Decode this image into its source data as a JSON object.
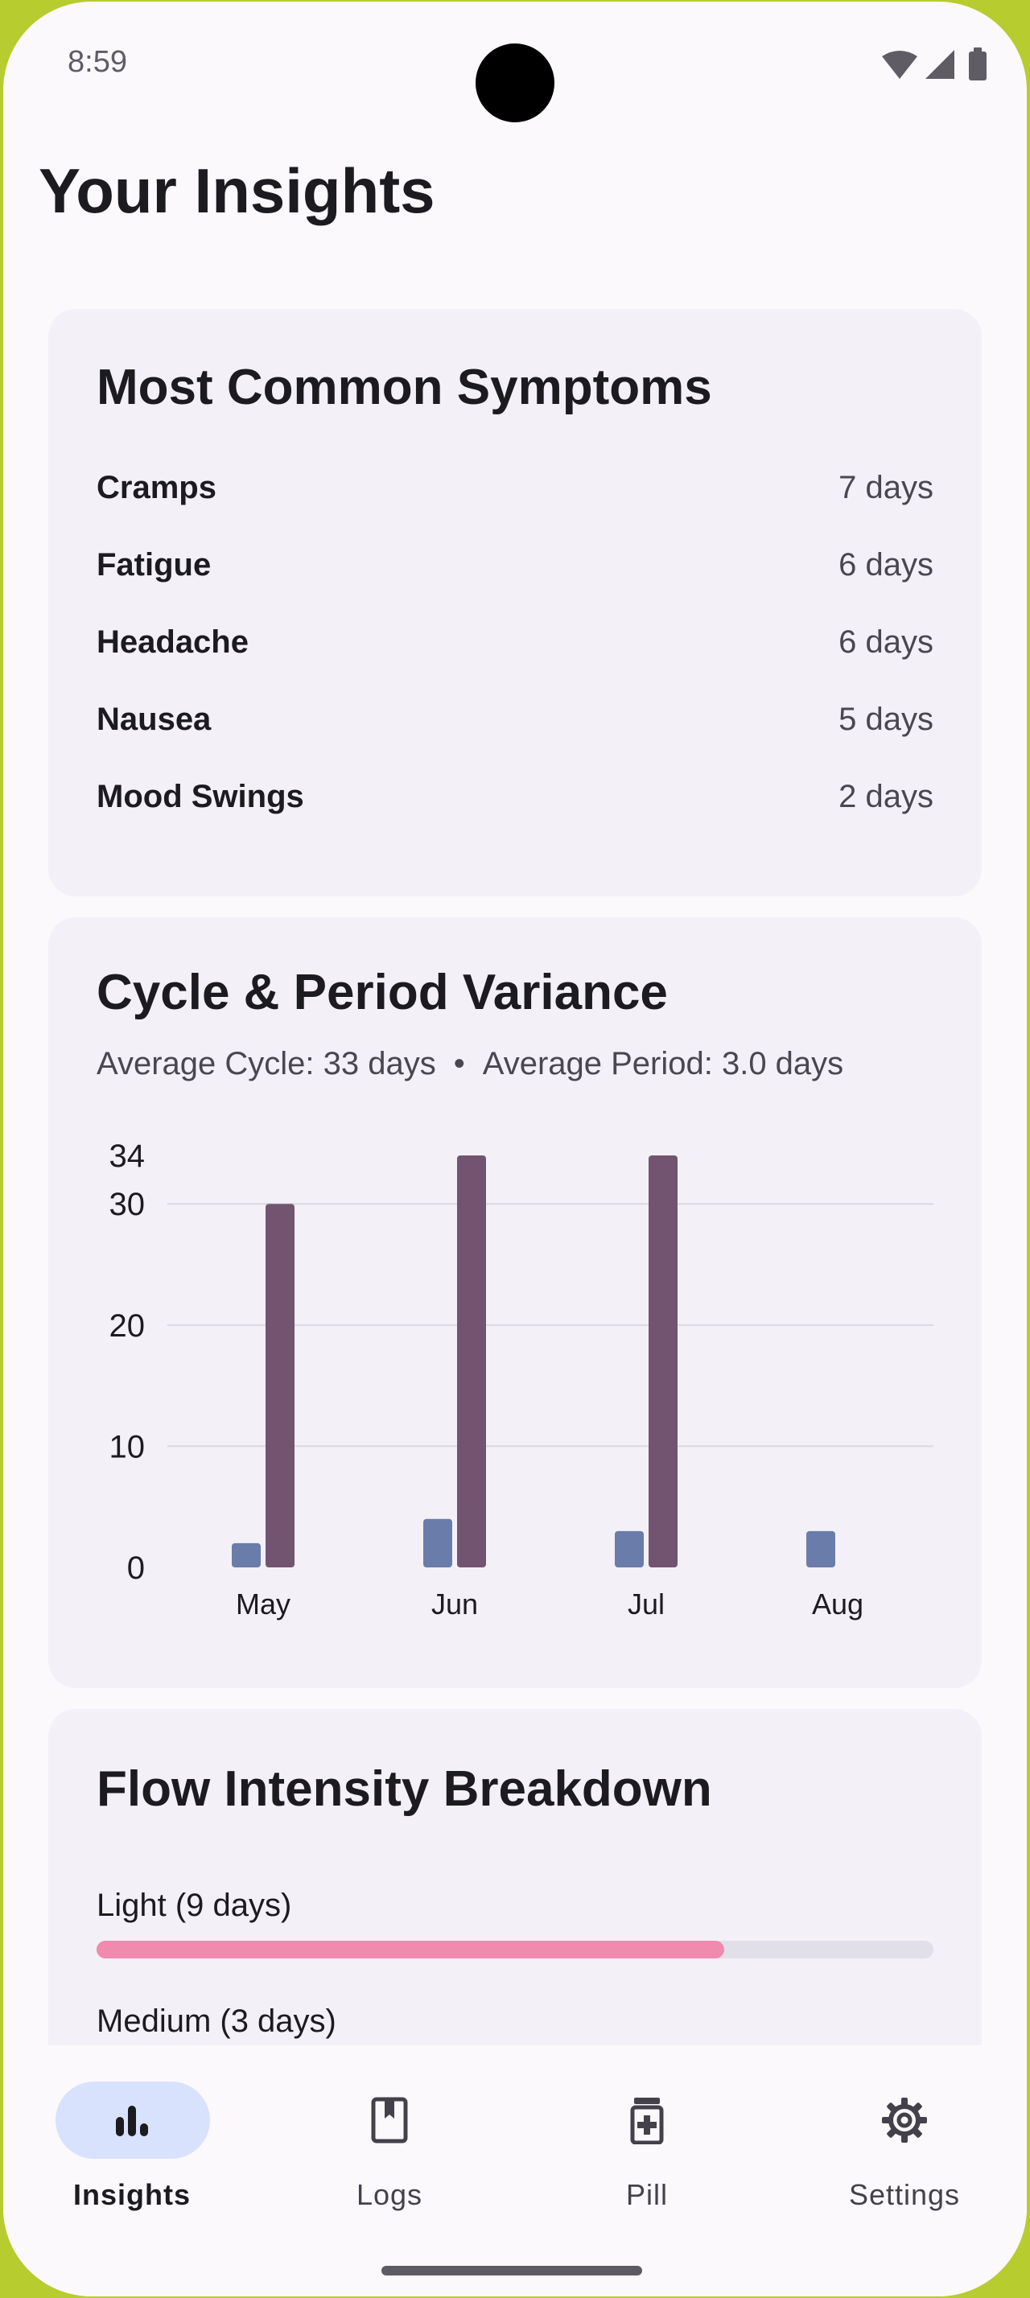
{
  "status_bar": {
    "time": "8:59",
    "icons": [
      "wifi-icon",
      "signal-icon",
      "battery-icon"
    ]
  },
  "page": {
    "title": "Your Insights"
  },
  "symptoms_card": {
    "title": "Most Common Symptoms",
    "items": [
      {
        "name": "Cramps",
        "days": "7 days"
      },
      {
        "name": "Fatigue",
        "days": "6 days"
      },
      {
        "name": "Headache",
        "days": "6 days"
      },
      {
        "name": "Nausea",
        "days": "5 days"
      },
      {
        "name": "Mood Swings",
        "days": "2 days"
      }
    ]
  },
  "variance_card": {
    "title": "Cycle & Period Variance",
    "avg_cycle": "Average Cycle: 33 days",
    "separator": "•",
    "avg_period": "Average Period: 3.0 days"
  },
  "chart_data": {
    "type": "bar",
    "title": "",
    "xlabel": "",
    "ylabel": "",
    "categories": [
      "May",
      "Jun",
      "Jul",
      "Aug"
    ],
    "ylim": [
      0,
      34
    ],
    "yticks": [
      "0",
      "10",
      "20",
      "30",
      "34"
    ],
    "grid": true,
    "series": [
      {
        "values": [
          2,
          4,
          3,
          3
        ],
        "color": "#6a7caa"
      },
      {
        "values": [
          30,
          34,
          34,
          null
        ],
        "color": "#735470"
      }
    ]
  },
  "flow_card": {
    "title": "Flow Intensity Breakdown",
    "items": [
      {
        "label": "Light (9 days)",
        "fraction": 0.75,
        "color": "#f08aae"
      },
      {
        "label": "Medium (3 days)",
        "fraction": 0.25,
        "color": "#f08aae"
      }
    ]
  },
  "bottom_nav": {
    "items": [
      {
        "label": "Insights",
        "icon": "bar-chart-icon",
        "active": true
      },
      {
        "label": "Logs",
        "icon": "book-icon",
        "active": false
      },
      {
        "label": "Pill",
        "icon": "medication-icon",
        "active": false
      },
      {
        "label": "Settings",
        "icon": "gear-icon",
        "active": false
      }
    ]
  },
  "colors": {
    "accent": "#d9e2fc",
    "period_bar": "#6a7caa",
    "cycle_bar": "#735470",
    "flow_light": "#f08aae"
  }
}
